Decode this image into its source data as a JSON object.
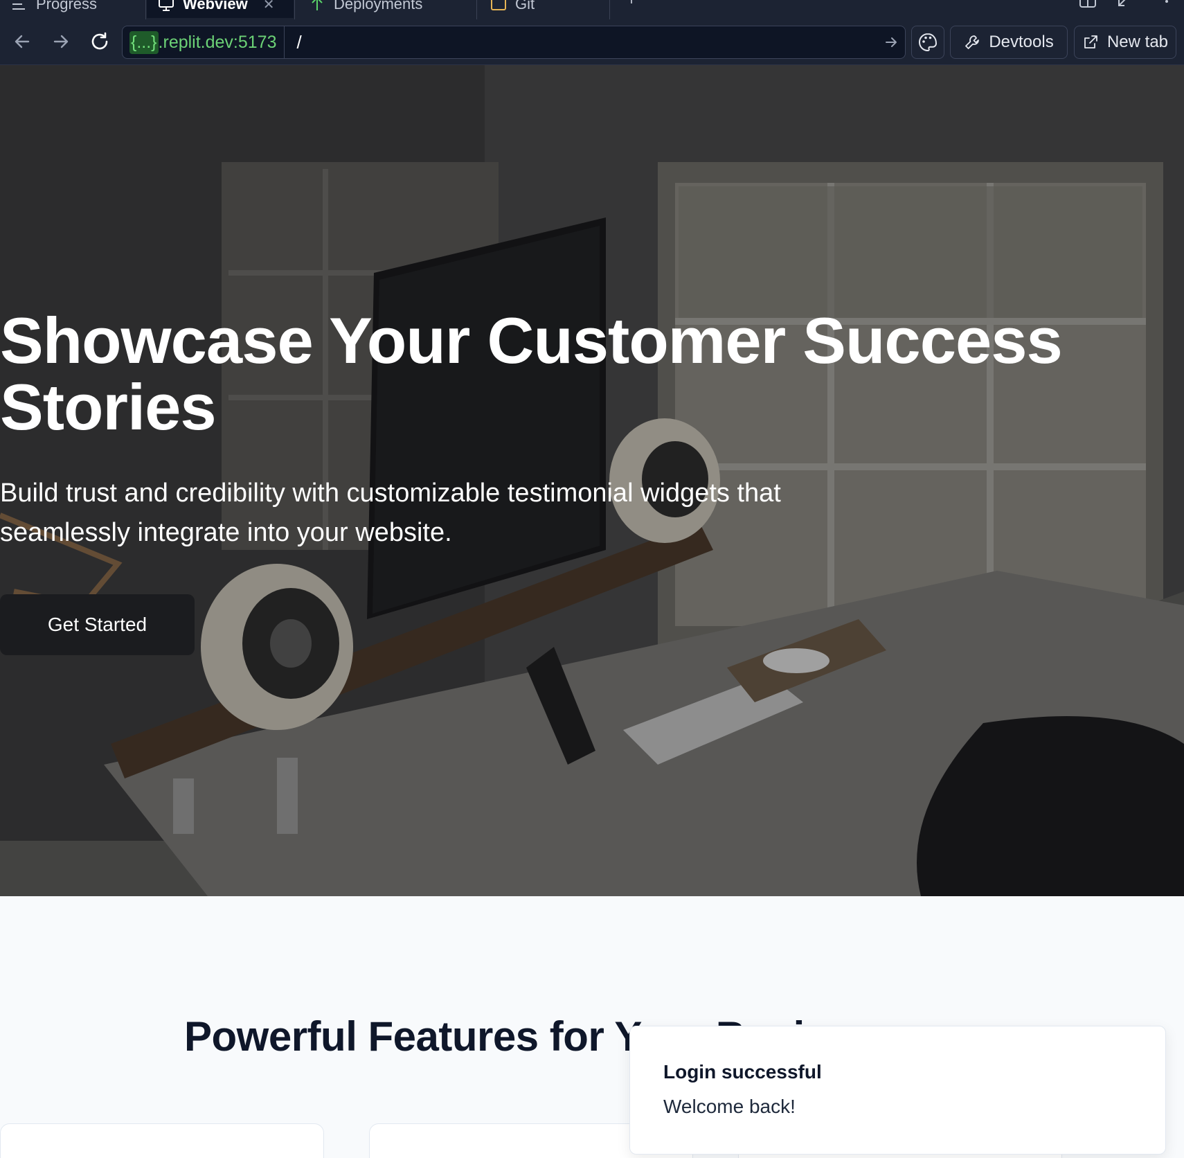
{
  "tabs": [
    {
      "label": "Progress",
      "icon": "progress-icon",
      "active": false
    },
    {
      "label": "Webview",
      "icon": "monitor-icon",
      "active": true
    },
    {
      "label": "Deployments",
      "icon": "deploy-icon",
      "active": false
    },
    {
      "label": "Git",
      "icon": "terminal-icon",
      "active": false
    }
  ],
  "url": {
    "braces": "{...}",
    "host_suffix": ".replit.dev:5173",
    "path": "/"
  },
  "toolbar": {
    "devtools_label": "Devtools",
    "newtab_label": "New tab"
  },
  "hero": {
    "title": "Showcase Your Customer Success Stories",
    "subtitle": "Build trust and credibility with customizable testimonial widgets that seamlessly integrate into your website.",
    "cta_label": "Get Started"
  },
  "features": {
    "title": "Powerful Features for Your Business"
  },
  "toast": {
    "title": "Login successful",
    "message": "Welcome back!"
  },
  "colors": {
    "host_text": "#6cd276",
    "chrome_bg": "#1c2333",
    "cta_bg": "#1b1c1f",
    "page_bg": "#f8fafc"
  }
}
